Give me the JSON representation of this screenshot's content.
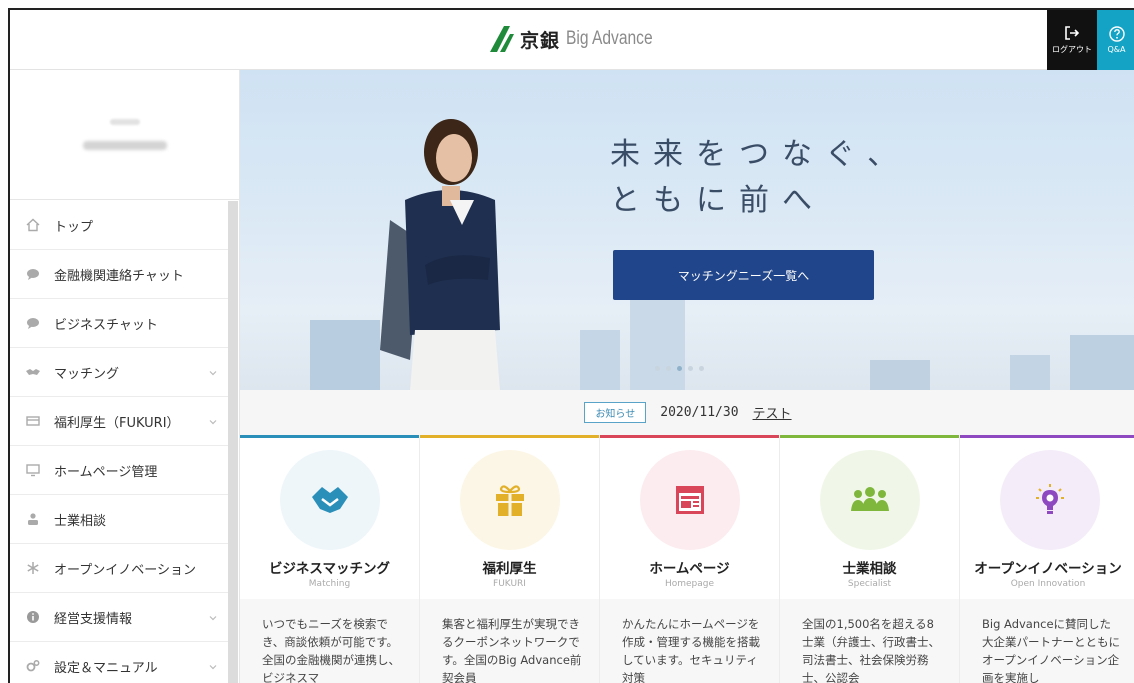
{
  "header": {
    "logo_bank": "京銀",
    "logo_product": "Big Advance",
    "logout_label": "ログアウト",
    "qa_label": "Q&A"
  },
  "sidebar": {
    "items": [
      {
        "label": "トップ",
        "icon": "home-icon",
        "has_submenu": false
      },
      {
        "label": "金融機関連絡チャット",
        "icon": "chat-bubble-icon",
        "has_submenu": false
      },
      {
        "label": "ビジネスチャット",
        "icon": "chat-bubble-icon",
        "has_submenu": false
      },
      {
        "label": "マッチング",
        "icon": "handshake-icon",
        "has_submenu": true
      },
      {
        "label": "福利厚生（FUKURI）",
        "icon": "card-icon",
        "has_submenu": true
      },
      {
        "label": "ホームページ管理",
        "icon": "monitor-icon",
        "has_submenu": false
      },
      {
        "label": "士業相談",
        "icon": "person-icon",
        "has_submenu": false
      },
      {
        "label": "オープンイノベーション",
        "icon": "asterisk-icon",
        "has_submenu": false
      },
      {
        "label": "経営支援情報",
        "icon": "info-icon",
        "has_submenu": true
      },
      {
        "label": "設定＆マニュアル",
        "icon": "gears-icon",
        "has_submenu": true
      }
    ]
  },
  "hero": {
    "slogan_line1": "未来をつなぐ、",
    "slogan_line2": "ともに前へ",
    "cta_label": "マッチングニーズ一覧へ",
    "slide_count": 5,
    "active_slide": 3
  },
  "news": {
    "badge": "お知らせ",
    "date": "2020/11/30",
    "title": "テスト"
  },
  "cards": [
    {
      "title": "ビジネスマッチング",
      "subtitle": "Matching",
      "icon": "handshake-icon",
      "color": "#2a8fb9",
      "bg": "#eef6fa",
      "desc": "いつでもニーズを検索でき、商談依頼が可能です。全国の金融機関が連携し、ビジネスマ"
    },
    {
      "title": "福利厚生",
      "subtitle": "FUKURI",
      "icon": "gift-icon",
      "color": "#e3b02a",
      "bg": "#fcf6e6",
      "desc": "集客と福利厚生が実現できるクーポンネットワークです。全国のBig Advance前契会員"
    },
    {
      "title": "ホームページ",
      "subtitle": "Homepage",
      "icon": "webpage-icon",
      "color": "#d9465a",
      "bg": "#fcecef",
      "desc": "かんたんにホームページを作成・管理する機能を搭載しています。セキュリティ対策"
    },
    {
      "title": "士業相談",
      "subtitle": "Specialist",
      "icon": "people-group-icon",
      "color": "#7fb73d",
      "bg": "#f0f7e8",
      "desc": "全国の1,500名を超える8士業（弁護士、行政書士、司法書士、社会保険労務士、公認会"
    },
    {
      "title": "オープンイノベーション",
      "subtitle": "Open Innovation",
      "icon": "lightbulb-icon",
      "color": "#8e49c0",
      "bg": "#f4edf9",
      "desc": "Big Advanceに賛同した大企業パートナーとともにオープンイノベーション企画を実施し"
    }
  ]
}
